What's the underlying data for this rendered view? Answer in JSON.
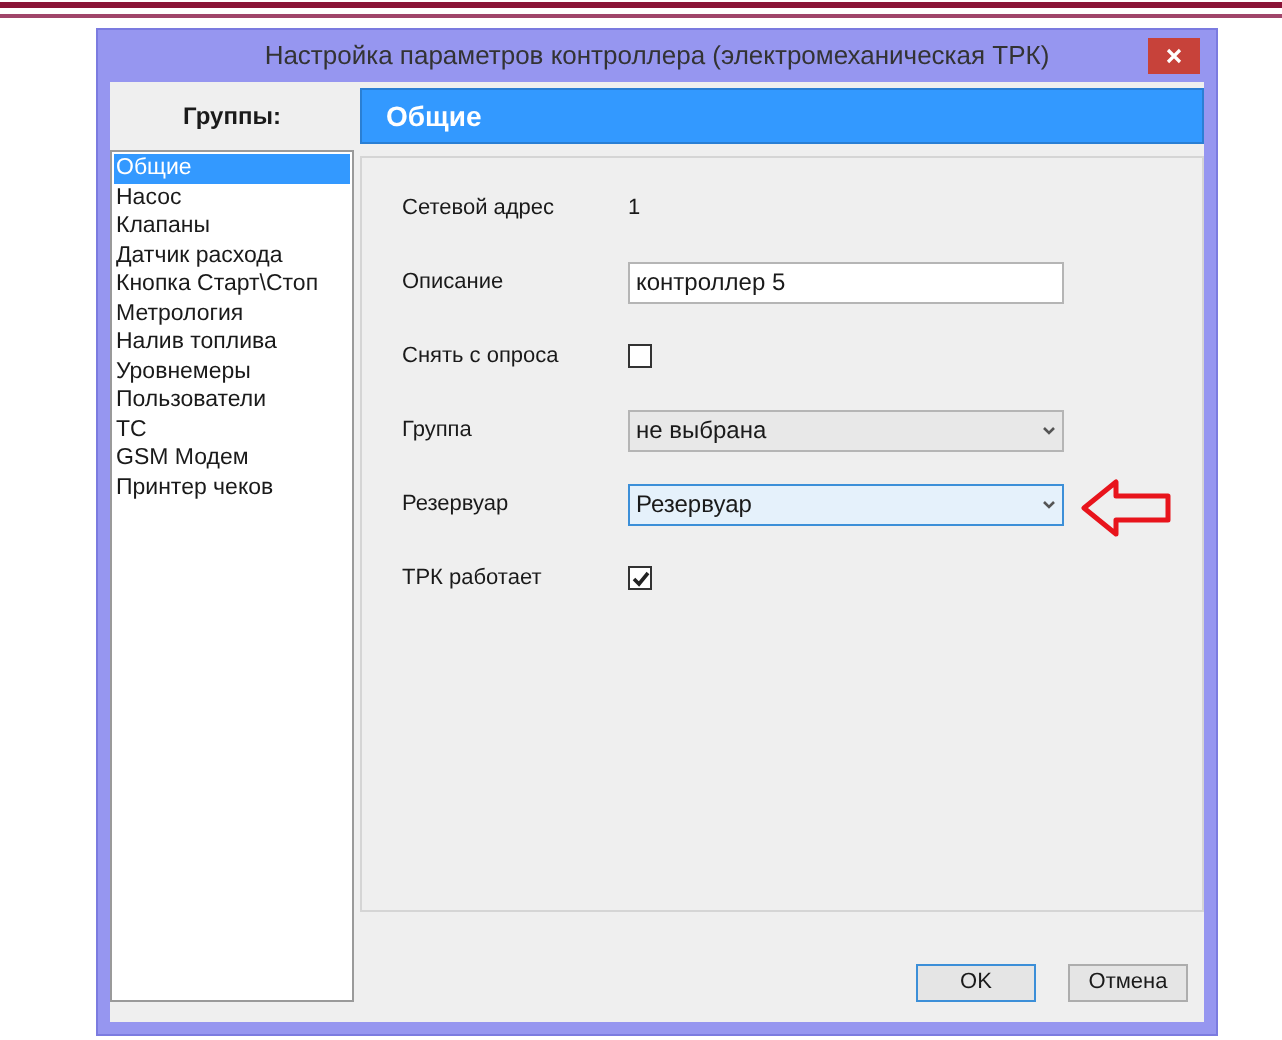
{
  "window": {
    "title": "Настройка параметров контроллера (электромеханическая ТРК)"
  },
  "groups_panel": {
    "heading": "Группы:",
    "items": [
      {
        "label": "Общие",
        "selected": true
      },
      {
        "label": "Насос",
        "selected": false
      },
      {
        "label": "Клапаны",
        "selected": false
      },
      {
        "label": "Датчик расхода",
        "selected": false
      },
      {
        "label": "Кнопка Старт\\Стоп",
        "selected": false
      },
      {
        "label": "Метрология",
        "selected": false
      },
      {
        "label": "Налив топлива",
        "selected": false
      },
      {
        "label": "Уровнемеры",
        "selected": false
      },
      {
        "label": "Пользователи",
        "selected": false
      },
      {
        "label": "ТС",
        "selected": false
      },
      {
        "label": "GSM Модем",
        "selected": false
      },
      {
        "label": "Принтер чеков",
        "selected": false
      }
    ]
  },
  "section": {
    "heading": "Общие",
    "fields": [
      {
        "kind": "text",
        "label": "Сетевой адрес",
        "value": "1"
      },
      {
        "kind": "input",
        "label": "Описание",
        "value": "контроллер 5"
      },
      {
        "kind": "checkbox",
        "label": "Снять с опроса",
        "checked": false
      },
      {
        "kind": "select",
        "label": "Группа",
        "value": "не выбрана",
        "focused": false
      },
      {
        "kind": "select",
        "label": "Резервуар",
        "value": "Резервуар",
        "focused": true
      },
      {
        "kind": "checkbox",
        "label": "ТРК работает",
        "checked": true
      }
    ]
  },
  "buttons": [
    {
      "label": "OK",
      "default": true
    },
    {
      "label": "Отмена",
      "default": false
    }
  ]
}
